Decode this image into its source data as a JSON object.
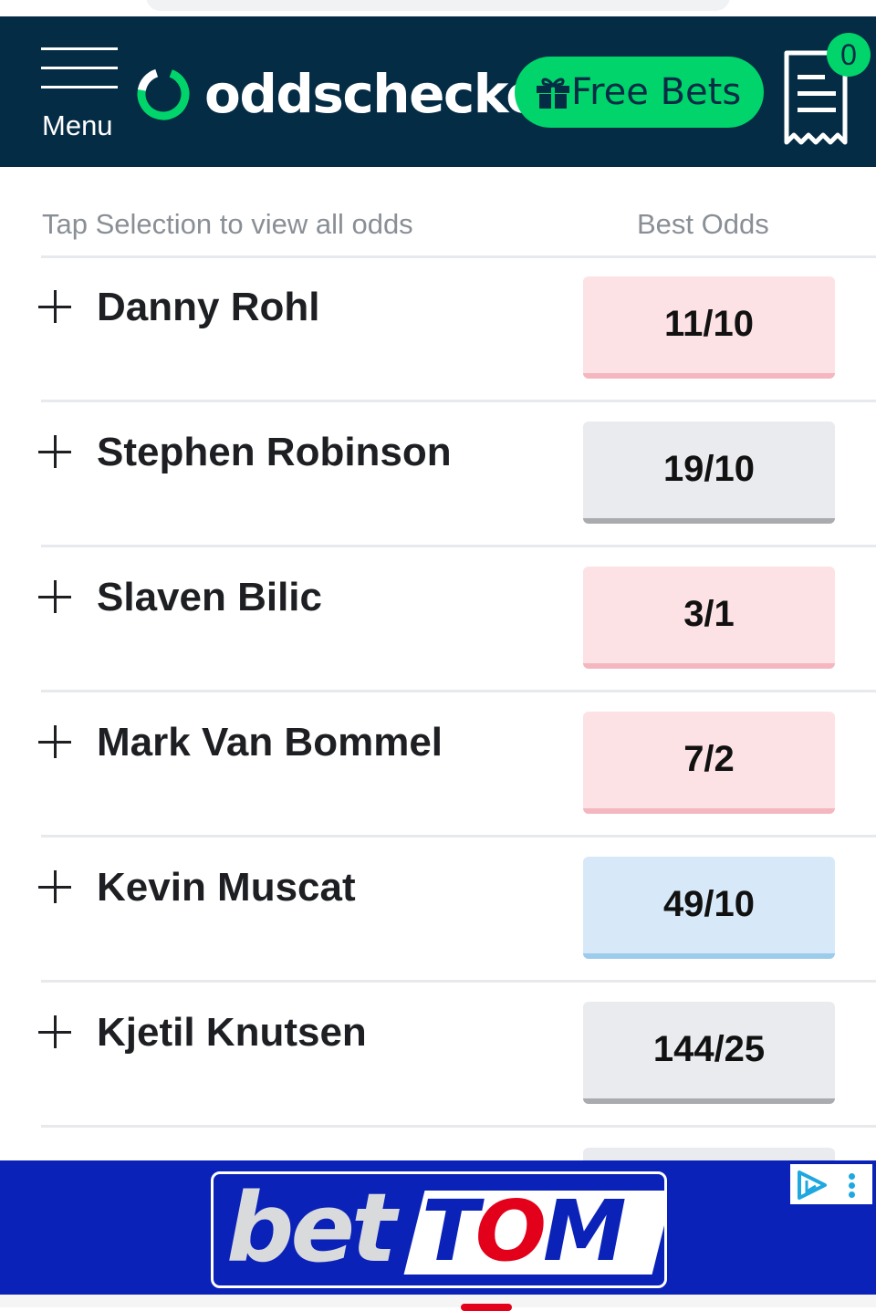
{
  "header": {
    "menu_label": "Menu",
    "logo_text": "oddschecker",
    "free_bets_label": "Free Bets",
    "betslip_count": "0"
  },
  "table": {
    "selection_heading": "Tap Selection to view all odds",
    "odds_heading": "Best Odds",
    "rows": [
      {
        "name": "Danny Rohl",
        "odds": "11/10",
        "style": "pink"
      },
      {
        "name": "Stephen Robinson",
        "odds": "19/10",
        "style": "grey"
      },
      {
        "name": "Slaven Bilic",
        "odds": "3/1",
        "style": "pink"
      },
      {
        "name": "Mark Van Bommel",
        "odds": "7/2",
        "style": "pink"
      },
      {
        "name": "Kevin Muscat",
        "odds": "49/10",
        "style": "blue"
      },
      {
        "name": "Kjetil Knutsen",
        "odds": "144/25",
        "style": "grey"
      }
    ]
  },
  "ad": {
    "brand_part1": "bet",
    "brand_part2_t": "T",
    "brand_part2_o": "O",
    "brand_part2_m": "M"
  },
  "colors": {
    "header_bg": "#052c45",
    "brand_green": "#00d46a",
    "odds_pink": "#fde2e5",
    "odds_grey": "#e9ebee",
    "odds_blue": "#d7e9f8",
    "ad_blue": "#0a22b8",
    "ad_red": "#e3001b"
  },
  "icons": {
    "menu": "hamburger-icon",
    "logo": "oddschecker-ring-icon",
    "gift": "gift-icon",
    "betslip": "receipt-icon",
    "expand": "plus-icon",
    "adchoices": "adchoices-icon"
  }
}
